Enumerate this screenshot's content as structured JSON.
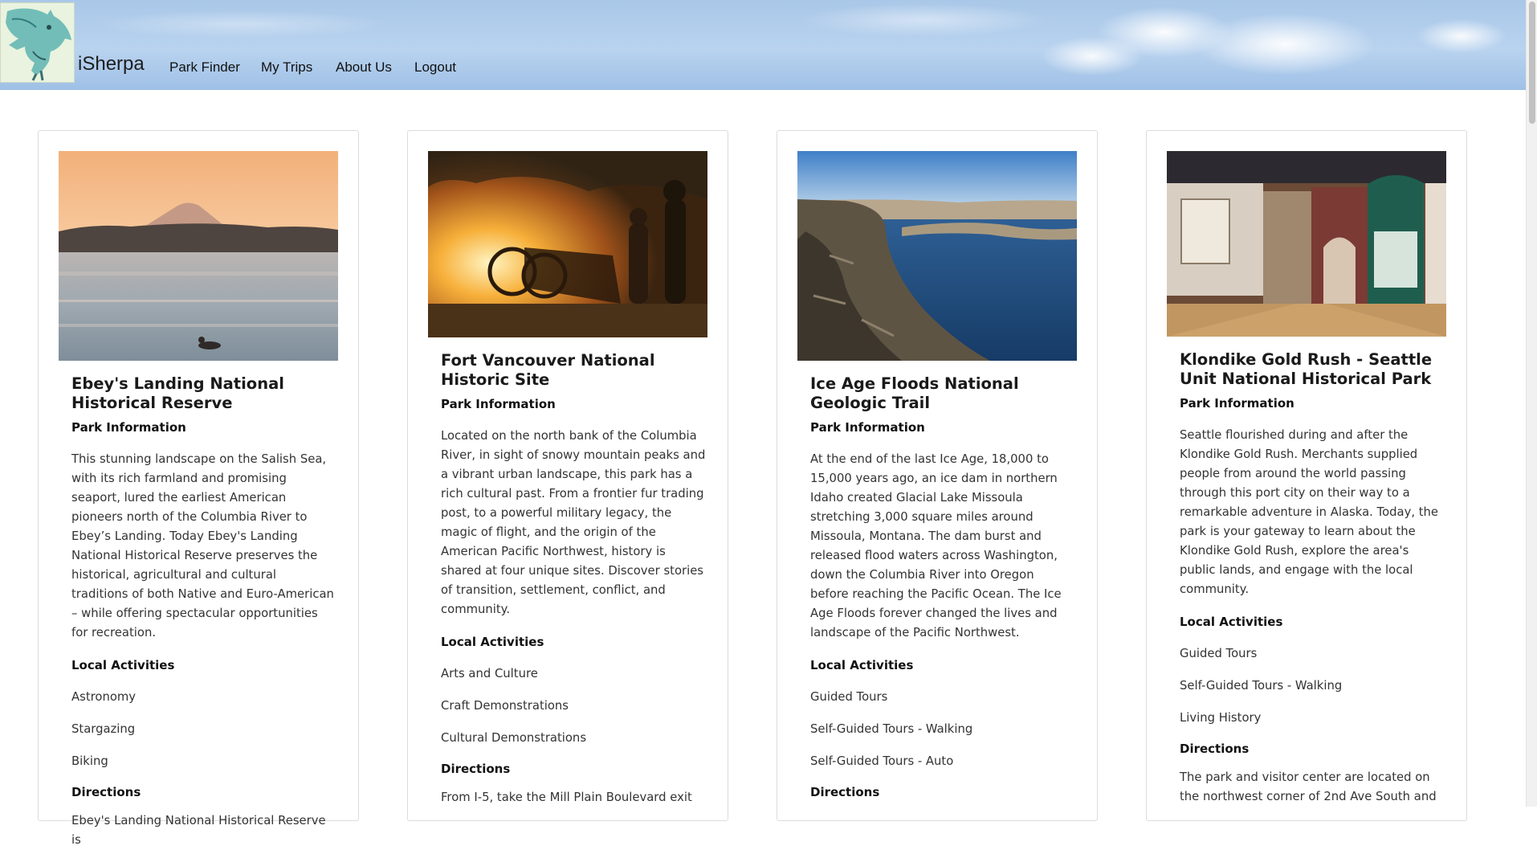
{
  "header": {
    "brand": "iSherpa",
    "nav": [
      "Park Finder",
      "My Trips",
      "About Us",
      "Logout"
    ]
  },
  "cards": [
    {
      "title": "Ebey's Landing National Historical Reserve",
      "info_label": "Park Information",
      "description": "This stunning landscape on the Salish Sea, with its rich farmland and promising seaport, lured the earliest American pioneers north of the Columbia River to Ebey’s Landing. Today Ebey's Landing National Historical Reserve preserves the historical, agricultural and cultural traditions of both Native and Euro-American – while offering spectacular opportunities for recreation.",
      "activities_label": "Local Activities",
      "activities": [
        "Astronomy",
        "Stargazing",
        "Biking"
      ],
      "directions_label": "Directions",
      "directions": "Ebey's Landing National Historical Reserve is"
    },
    {
      "title": "Fort Vancouver National Historic Site",
      "info_label": "Park Information",
      "description": "Located on the north bank of the Columbia River, in sight of snowy mountain peaks and a vibrant urban landscape, this park has a rich cultural past. From a frontier fur trading post, to a powerful military legacy, the magic of flight, and the origin of the American Pacific Northwest, history is shared at four unique sites. Discover stories of transition, settlement, conflict, and community.",
      "activities_label": "Local Activities",
      "activities": [
        "Arts and Culture",
        "Craft Demonstrations",
        "Cultural Demonstrations"
      ],
      "directions_label": "Directions",
      "directions": "From I-5, take the Mill Plain Boulevard exit"
    },
    {
      "title": "Ice Age Floods National Geologic Trail",
      "info_label": "Park Information",
      "description": "At the end of the last Ice Age, 18,000 to 15,000 years ago, an ice dam in northern Idaho created Glacial Lake Missoula stretching 3,000 square miles around Missoula, Montana. The dam burst and released flood waters across Washington, down the Columbia River into Oregon before reaching the Pacific Ocean. The Ice Age Floods forever changed the lives and landscape of the Pacific Northwest.",
      "activities_label": "Local Activities",
      "activities": [
        "Guided Tours",
        "Self-Guided Tours - Walking",
        "Self-Guided Tours - Auto"
      ],
      "directions_label": "Directions",
      "directions": ""
    },
    {
      "title": "Klondike Gold Rush - Seattle Unit National Historical Park",
      "info_label": "Park Information",
      "description": "Seattle flourished during and after the Klondike Gold Rush. Merchants supplied people from around the world passing through this port city on their way to a remarkable adventure in Alaska. Today, the park is your gateway to learn about the Klondike Gold Rush, explore the area's public lands, and engage with the local community.",
      "activities_label": "Local Activities",
      "activities": [
        "Guided Tours",
        "Self-Guided Tours - Walking",
        "Living History"
      ],
      "directions_label": "Directions",
      "directions": "The park and visitor center are located on the northwest corner of 2nd Ave South and"
    }
  ]
}
